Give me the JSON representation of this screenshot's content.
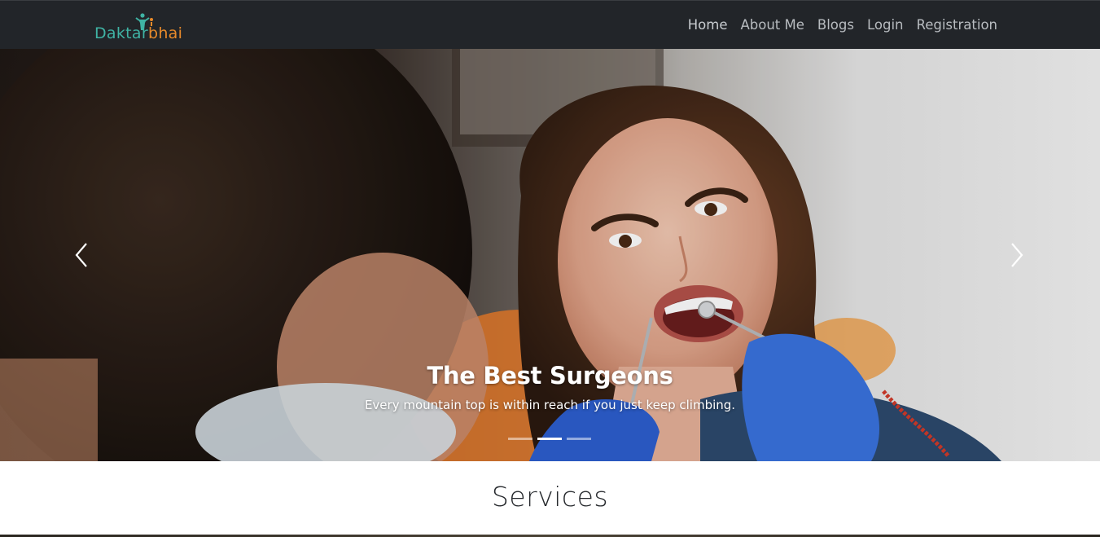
{
  "brand": {
    "part1": "Daktar",
    "part2": "bhai"
  },
  "nav": {
    "items": [
      {
        "label": "Home"
      },
      {
        "label": "About Me"
      },
      {
        "label": "Blogs"
      },
      {
        "label": "Login"
      },
      {
        "label": "Registration"
      }
    ]
  },
  "carousel": {
    "title": "The Best Surgeons",
    "text": "Every mountain top is within reach if you just keep climbing.",
    "slides_total": 3,
    "active_slide": 2,
    "prev_icon": "chevron-left-icon",
    "next_icon": "chevron-right-icon"
  },
  "services": {
    "title": "Services"
  },
  "colors": {
    "navbar_bg": "#222529",
    "brand_teal": "#3fb3a4",
    "brand_orange": "#e88a2a",
    "nav_text": "#b8bcc0"
  }
}
